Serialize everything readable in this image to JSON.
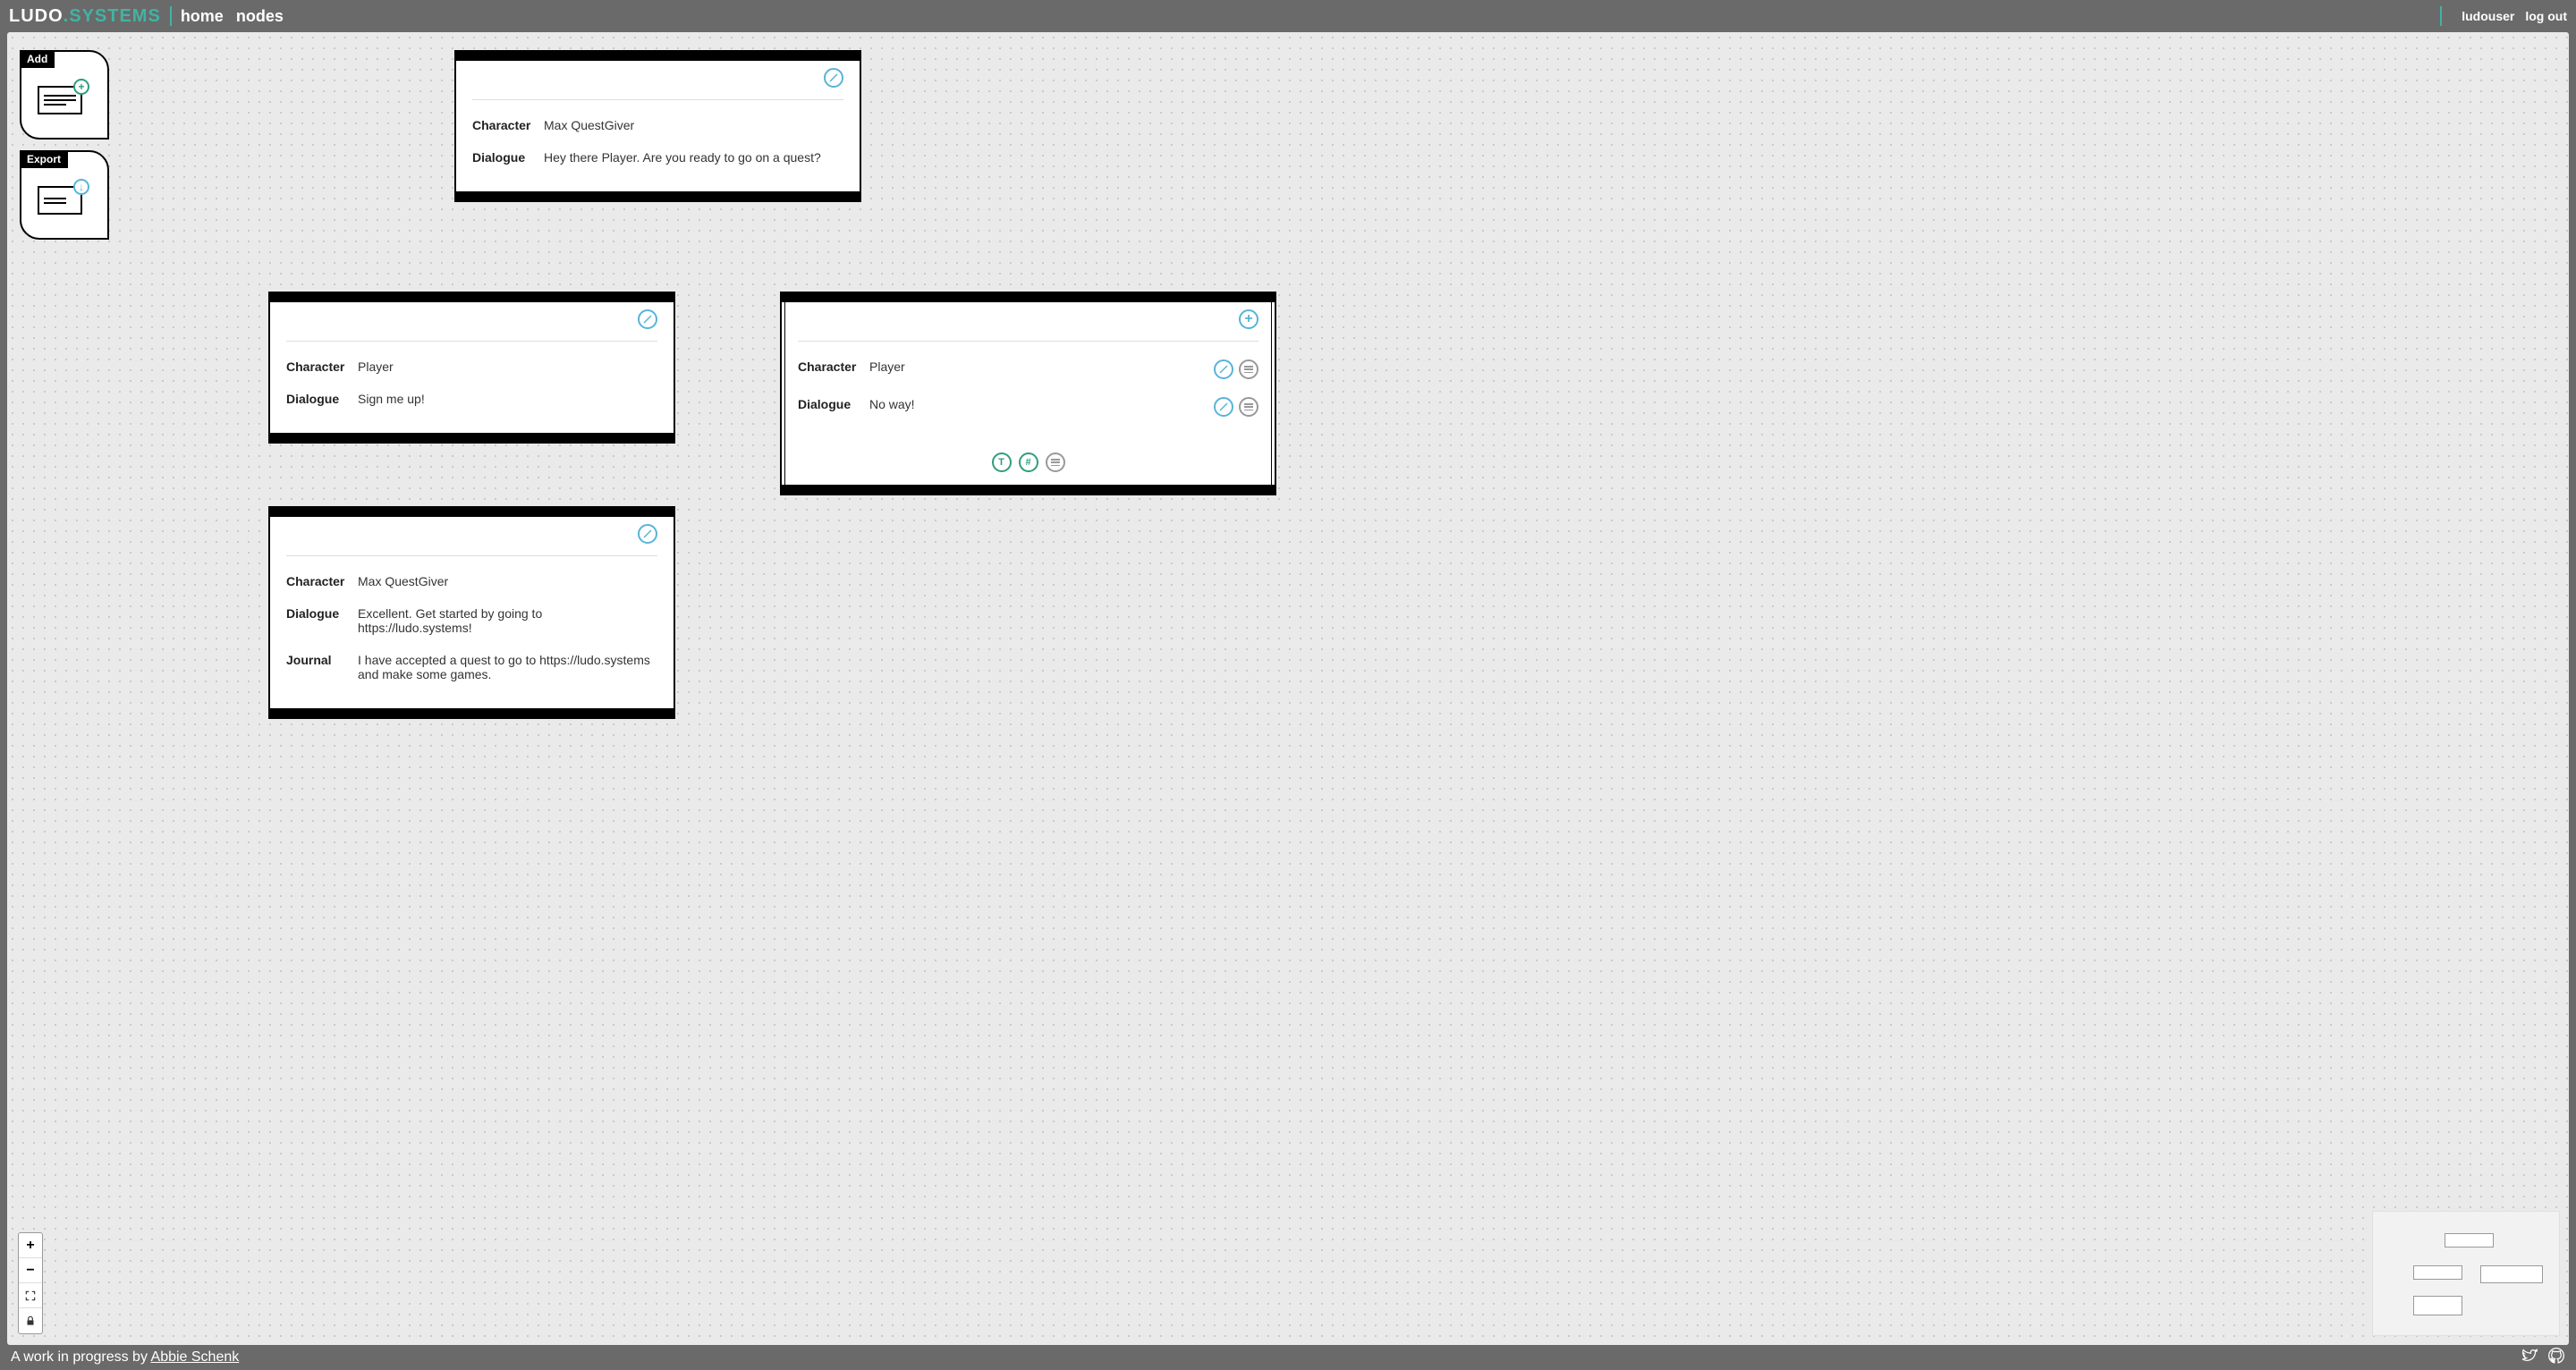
{
  "header": {
    "logo_a": "LUDO",
    "logo_dot": ".",
    "logo_b": "SYSTEMS",
    "nav_home": "home",
    "nav_nodes": "nodes",
    "username": "ludouser",
    "logout": "log out"
  },
  "toolbox": {
    "add_label": "Add",
    "export_label": "Export"
  },
  "labels": {
    "character": "Character",
    "dialogue": "Dialogue",
    "journal": "Journal"
  },
  "nodes": {
    "n1": {
      "character": "Max QuestGiver",
      "dialogue": "Hey there Player. Are you ready to go on a quest?"
    },
    "n2": {
      "character": "Player",
      "dialogue": "Sign me up!"
    },
    "n3": {
      "character": "Player",
      "dialogue": "No way!"
    },
    "n4": {
      "character": "Max QuestGiver",
      "dialogue": "Excellent. Get started by going to https://ludo.systems!",
      "journal": "I have accepted a quest to go to https://ludo.systems and make some games."
    }
  },
  "footer": {
    "prefix": "A work in progress by ",
    "author": "Abbie Schenk"
  },
  "icons": {
    "type_t": "T",
    "type_hash": "#",
    "plus": "+"
  }
}
